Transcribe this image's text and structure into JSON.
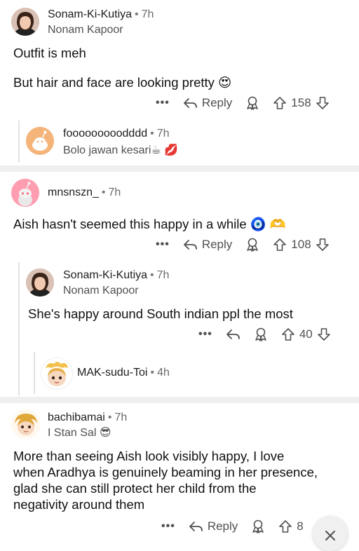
{
  "comments": [
    {
      "user": "Sonam-Ki-Kutiya",
      "time": "7h",
      "flair": "Nonam Kapoor",
      "lines": [
        "Outfit is meh",
        "But hair and face are looking pretty 😍"
      ],
      "reply_label": "Reply",
      "votes": "158",
      "replies": [
        {
          "user": "fooooooooodddd",
          "time": "7h",
          "flair": "Bolo jawan kesari☕ 💋"
        }
      ]
    },
    {
      "user": "mnsnszn_",
      "time": "7h",
      "text": "Aish hasn't seemed this happy in a while 🧿 🫶",
      "reply_label": "Reply",
      "votes": "108",
      "replies": [
        {
          "user": "Sonam-Ki-Kutiya",
          "time": "7h",
          "flair": "Nonam Kapoor",
          "text": "She's happy around South indian ppl the most",
          "votes": "40",
          "replies": [
            {
              "user": "MAK-sudu-Toi",
              "time": "4h"
            }
          ]
        }
      ]
    },
    {
      "user": "bachibamai",
      "time": "7h",
      "flair": "I Stan Sal 😎",
      "lines": [
        "More than seeing Aish look visibly happy, I love",
        "when Aradhya is genuinely beaming in her presence,",
        "glad she can still protect her child from the",
        "negativity around them"
      ],
      "reply_label": "Reply",
      "votes": "8"
    }
  ],
  "ui": {
    "more_dots": "•••",
    "dot_sep": "•"
  },
  "colors": {
    "separator": "#efefef",
    "meta_text": "#505050"
  }
}
